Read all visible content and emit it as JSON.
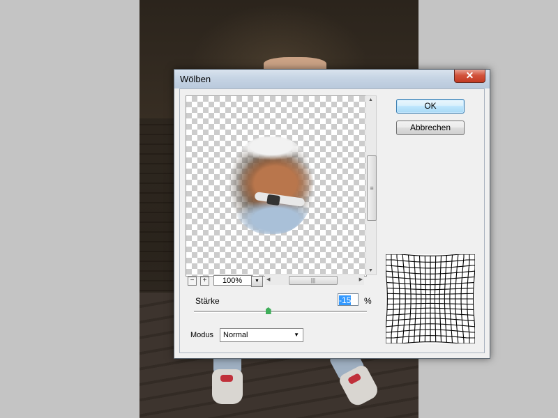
{
  "dialog": {
    "title": "Wölben",
    "close_label": "✕"
  },
  "buttons": {
    "ok_label": "OK",
    "cancel_label": "Abbrechen"
  },
  "preview": {
    "zoom_out_label": "−",
    "zoom_in_label": "+",
    "zoom_value": "100%"
  },
  "amount": {
    "label": "Stärke",
    "value": "-15",
    "unit": "%",
    "slider_fraction": 0.43
  },
  "mode": {
    "label": "Modus",
    "selected": "Normal"
  },
  "icons": {
    "close": "close-icon",
    "zoom_dropdown": "chevron-down-icon",
    "scroll_up": "arrow-up-icon",
    "scroll_down": "arrow-down-icon",
    "scroll_left": "arrow-left-icon",
    "scroll_right": "arrow-right-icon",
    "mode_dropdown": "chevron-down-icon"
  },
  "colors": {
    "accent": "#3399ff",
    "slider_thumb": "#3fae5a",
    "close_button": "#c23a22"
  }
}
